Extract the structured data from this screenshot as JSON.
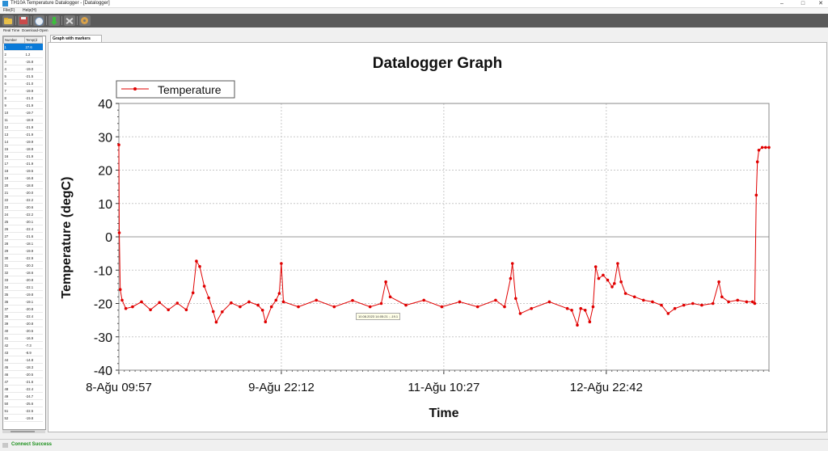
{
  "window": {
    "title": "TH10A Temperature Datalogger - [Datalogger]",
    "controls": [
      "–",
      "□",
      "✕"
    ]
  },
  "menu": {
    "items": [
      "File(F)",
      "Help(H)"
    ]
  },
  "toolbar": {
    "buttons": [
      "folder-open-icon",
      "save-icon",
      "clock-icon",
      "download-icon",
      "tools-icon",
      "settings-icon"
    ]
  },
  "left_tabs": [
    "Real Time",
    "Download-Open"
  ],
  "table": {
    "headers": [
      "Number",
      "Temp(d"
    ],
    "rows": [
      [
        "1",
        "27.6"
      ],
      [
        "2",
        "1.2"
      ],
      [
        "3",
        "-15.8"
      ],
      [
        "4",
        "-19.0"
      ],
      [
        "5",
        "-21.5"
      ],
      [
        "6",
        "-21.0"
      ],
      [
        "7",
        "-19.9"
      ],
      [
        "8",
        "-21.0"
      ],
      [
        "9",
        "-21.9"
      ],
      [
        "10",
        "-19.7"
      ],
      [
        "11",
        "-18.9"
      ],
      [
        "12",
        "-21.9"
      ],
      [
        "13",
        "-21.9"
      ],
      [
        "14",
        "-19.9"
      ],
      [
        "15",
        "-18.8"
      ],
      [
        "16",
        "-21.9"
      ],
      [
        "17",
        "-21.9"
      ],
      [
        "18",
        "-19.5"
      ],
      [
        "19",
        "-16.8"
      ],
      [
        "20",
        "-18.8"
      ],
      [
        "21",
        "-20.0"
      ],
      [
        "22",
        "-22.2"
      ],
      [
        "23",
        "-20.6"
      ],
      [
        "24",
        "-22.2"
      ],
      [
        "25",
        "-20.1"
      ],
      [
        "26",
        "-22.4"
      ],
      [
        "27",
        "-21.6"
      ],
      [
        "28",
        "-18.1"
      ],
      [
        "29",
        "-19.9"
      ],
      [
        "30",
        "-22.9"
      ],
      [
        "31",
        "-20.3"
      ],
      [
        "32",
        "-18.6"
      ],
      [
        "33",
        "-20.8"
      ],
      [
        "34",
        "-22.1"
      ],
      [
        "35",
        "-19.8"
      ],
      [
        "36",
        "-19.1"
      ],
      [
        "37",
        "-20.8"
      ],
      [
        "38",
        "-22.4"
      ],
      [
        "39",
        "-20.8"
      ],
      [
        "40",
        "-20.5"
      ],
      [
        "41",
        "-16.9"
      ],
      [
        "42",
        "-7.3"
      ],
      [
        "43",
        "-8.9"
      ],
      [
        "44",
        "-14.8"
      ],
      [
        "45",
        "-18.3"
      ],
      [
        "46",
        "-20.5"
      ],
      [
        "47",
        "-21.6"
      ],
      [
        "48",
        "-22.4"
      ],
      [
        "49",
        "-24.7"
      ],
      [
        "50",
        "-25.6"
      ],
      [
        "51",
        "-22.5"
      ],
      [
        "52",
        "-19.8"
      ]
    ]
  },
  "graph_tab": "Graph with markers",
  "tooltip": "10.08.2023 14:05:21 ; -19.1",
  "status": "Connect Success",
  "colors": {
    "series": "#e00000",
    "toolbar": "#5a5a5a",
    "selected": "#0a7ad8",
    "status": "#1a8f1a"
  },
  "chart_data": {
    "type": "line",
    "title": "Datalogger Graph",
    "xlabel": "Time",
    "ylabel": "Temperature (degC)",
    "legend": "top-left",
    "grid": true,
    "ylim": [
      -40,
      40
    ],
    "yticks": [
      40,
      30,
      20,
      10,
      0,
      -10,
      -20,
      -30,
      -40
    ],
    "xlim": [
      "2023-08-08 09:57",
      "2023-08-14 11:00"
    ],
    "xticks": [
      {
        "label": "8-Ağu 09:57",
        "t": "2023-08-08 09:57"
      },
      {
        "label": "9-Ağu 22:12",
        "t": "2023-08-09 22:12"
      },
      {
        "label": "11-Ağu 10:27",
        "t": "2023-08-11 10:27"
      },
      {
        "label": "12-Ağu 22:42",
        "t": "2023-08-12 22:42"
      }
    ],
    "series": [
      {
        "name": "Temperature",
        "points": [
          [
            "2023-08-08 09:57",
            27.6
          ],
          [
            "2023-08-08 10:02",
            1.2
          ],
          [
            "2023-08-08 10:15",
            -15.8
          ],
          [
            "2023-08-08 10:40",
            -19.0
          ],
          [
            "2023-08-08 11:30",
            -21.5
          ],
          [
            "2023-08-08 13:00",
            -21.0
          ],
          [
            "2023-08-08 15:00",
            -19.5
          ],
          [
            "2023-08-08 17:00",
            -21.9
          ],
          [
            "2023-08-08 19:00",
            -19.7
          ],
          [
            "2023-08-08 21:00",
            -21.9
          ],
          [
            "2023-08-08 23:00",
            -19.9
          ],
          [
            "2023-08-09 01:00",
            -21.9
          ],
          [
            "2023-08-09 02:30",
            -16.8
          ],
          [
            "2023-08-09 03:15",
            -7.3
          ],
          [
            "2023-08-09 04:00",
            -8.9
          ],
          [
            "2023-08-09 05:00",
            -14.8
          ],
          [
            "2023-08-09 06:00",
            -18.3
          ],
          [
            "2023-08-09 07:00",
            -22.4
          ],
          [
            "2023-08-09 07:40",
            -25.6
          ],
          [
            "2023-08-09 09:00",
            -22.5
          ],
          [
            "2023-08-09 11:00",
            -19.8
          ],
          [
            "2023-08-09 13:00",
            -21.0
          ],
          [
            "2023-08-09 15:00",
            -19.5
          ],
          [
            "2023-08-09 17:00",
            -20.5
          ],
          [
            "2023-08-09 18:00",
            -22.0
          ],
          [
            "2023-08-09 18:40",
            -25.5
          ],
          [
            "2023-08-09 20:00",
            -21.0
          ],
          [
            "2023-08-09 21:00",
            -19.0
          ],
          [
            "2023-08-09 21:45",
            -17.0
          ],
          [
            "2023-08-09 22:12",
            -8.0
          ],
          [
            "2023-08-09 22:40",
            -19.5
          ],
          [
            "2023-08-10 02:00",
            -21.0
          ],
          [
            "2023-08-10 06:00",
            -19.0
          ],
          [
            "2023-08-10 10:00",
            -21.0
          ],
          [
            "2023-08-10 14:05",
            -19.1
          ],
          [
            "2023-08-10 18:00",
            -21.0
          ],
          [
            "2023-08-10 20:30",
            -20.0
          ],
          [
            "2023-08-10 21:30",
            -13.5
          ],
          [
            "2023-08-10 22:30",
            -18.0
          ],
          [
            "2023-08-11 02:00",
            -20.5
          ],
          [
            "2023-08-11 06:00",
            -19.0
          ],
          [
            "2023-08-11 10:00",
            -21.0
          ],
          [
            "2023-08-11 14:00",
            -19.5
          ],
          [
            "2023-08-11 18:00",
            -21.0
          ],
          [
            "2023-08-11 22:00",
            -19.0
          ],
          [
            "2023-08-12 00:00",
            -21.0
          ],
          [
            "2023-08-12 01:20",
            -12.5
          ],
          [
            "2023-08-12 01:45",
            -8.0
          ],
          [
            "2023-08-12 02:30",
            -18.5
          ],
          [
            "2023-08-12 03:30",
            -23.0
          ],
          [
            "2023-08-12 06:00",
            -21.5
          ],
          [
            "2023-08-12 10:00",
            -19.5
          ],
          [
            "2023-08-12 14:00",
            -21.5
          ],
          [
            "2023-08-12 15:00",
            -22.0
          ],
          [
            "2023-08-12 16:15",
            -26.5
          ],
          [
            "2023-08-12 17:00",
            -21.5
          ],
          [
            "2023-08-12 18:00",
            -22.0
          ],
          [
            "2023-08-12 19:00",
            -25.5
          ],
          [
            "2023-08-12 19:45",
            -21.0
          ],
          [
            "2023-08-12 20:20",
            -9.0
          ],
          [
            "2023-08-12 21:00",
            -12.5
          ],
          [
            "2023-08-12 22:00",
            -11.5
          ],
          [
            "2023-08-12 23:00",
            -13.0
          ],
          [
            "2023-08-13 00:00",
            -15.0
          ],
          [
            "2023-08-13 00:30",
            -14.0
          ],
          [
            "2023-08-13 01:15",
            -8.0
          ],
          [
            "2023-08-13 02:00",
            -13.5
          ],
          [
            "2023-08-13 03:00",
            -17.0
          ],
          [
            "2023-08-13 05:00",
            -18.0
          ],
          [
            "2023-08-13 07:00",
            -19.0
          ],
          [
            "2023-08-13 09:00",
            -19.5
          ],
          [
            "2023-08-13 11:00",
            -20.5
          ],
          [
            "2023-08-13 12:30",
            -23.0
          ],
          [
            "2023-08-13 14:00",
            -21.5
          ],
          [
            "2023-08-13 16:00",
            -20.5
          ],
          [
            "2023-08-13 18:00",
            -20.0
          ],
          [
            "2023-08-13 20:00",
            -20.5
          ],
          [
            "2023-08-13 22:30",
            -20.0
          ],
          [
            "2023-08-13 23:50",
            -13.5
          ],
          [
            "2023-08-14 00:30",
            -18.0
          ],
          [
            "2023-08-14 02:00",
            -19.5
          ],
          [
            "2023-08-14 04:00",
            -19.0
          ],
          [
            "2023-08-14 06:00",
            -19.5
          ],
          [
            "2023-08-14 07:20",
            -19.5
          ],
          [
            "2023-08-14 07:50",
            -20.0
          ],
          [
            "2023-08-14 08:10",
            12.5
          ],
          [
            "2023-08-14 08:25",
            22.5
          ],
          [
            "2023-08-14 08:45",
            26.0
          ],
          [
            "2023-08-14 09:30",
            26.8
          ],
          [
            "2023-08-14 10:15",
            26.8
          ],
          [
            "2023-08-14 11:00",
            26.8
          ]
        ]
      }
    ]
  }
}
